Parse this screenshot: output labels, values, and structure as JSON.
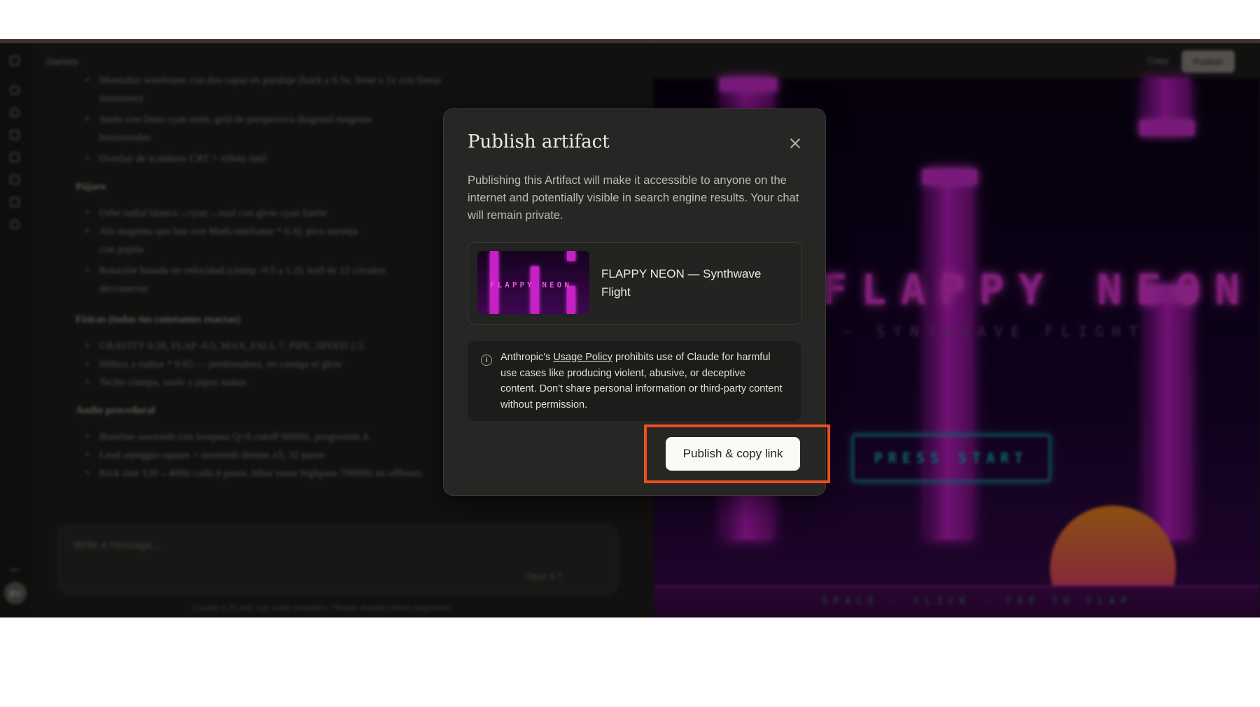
{
  "background": {
    "chat_title": "Games",
    "chat_lines": [
      {
        "text": "Montañas wireframe con dos capas en paralaje (back a 0.5x, front a 1x con líneas",
        "kind": "bullet"
      },
      {
        "text": "interiores)",
        "kind": "cont"
      },
      {
        "text": "Suelo con línea cyan neón, grid de perspectiva diagonal magenta",
        "kind": "bullet"
      },
      {
        "text": "horizontales",
        "kind": "cont"
      },
      {
        "text": "Overlay de scanlines CRT + viñeta sutil",
        "kind": "bullet"
      },
      {
        "text": "Pájaro",
        "kind": "heading"
      },
      {
        "text": "Orbe radial blanco→cyan→azul con glow cyan fuerte",
        "kind": "bullet"
      },
      {
        "text": "Ala magenta que late con Math.sin(frame * 0.4), pico naranja",
        "kind": "bullet"
      },
      {
        "text": "con pupila",
        "kind": "cont"
      },
      {
        "text": "Rotación basada en velocidad (clamp -0.5 a 1.2), trail de 12 círculos",
        "kind": "bullet"
      },
      {
        "text": "desvanecen",
        "kind": "cont"
      },
      {
        "text": "Físicas (todas tus constantes exactas)",
        "kind": "heading"
      },
      {
        "text": "GRAVITY 0.28, FLAP -6.5, MAX_FALL 7, PIPE_SPEED 2.5",
        "kind": "bullet"
      },
      {
        "text": "Hitbox a radius * 0.65 — perdonadora, no castiga el glow",
        "kind": "bullet"
      },
      {
        "text": "Techo clampa, suelo y pipes matan",
        "kind": "bullet"
      },
      {
        "text": "Audio procedural",
        "kind": "heading"
      },
      {
        "text": "Bassline sawtooth con lowpass Q=8 cutoff 600Hz, progresión A",
        "kind": "bullet"
      },
      {
        "text": "Lead arpeggio square + sawtooth detune ±5, 32 pasos",
        "kind": "bullet"
      },
      {
        "text": "Kick sine 120→40Hz cada 4 pasos, hihat noise highpass 7000Hz en offbeats",
        "kind": "bullet"
      }
    ],
    "composer_placeholder": "Write a message...",
    "model_label": "Opus 4.7",
    "disclaimer": "Claude is AI and can make mistakes. Please double-check responses.",
    "avatar_initials": "BV",
    "artifact_copy_label": "Copy",
    "artifact_publish_label": "Publish",
    "game_title": "FLAPPY NEON",
    "game_subtitle": "— SYNTHWAVE FLIGHT —",
    "game_press_start": "PRESS START",
    "game_controls": "SPACE · CLICK · TAP TO FLAP"
  },
  "modal": {
    "title": "Publish artifact",
    "description": "Publishing this Artifact will make it accessible to anyone on the internet and potentially visible in search engine results. Your chat will remain private.",
    "artifact_name": "FLAPPY NEON — Synthwave Flight",
    "thumbnail_text": "FLAPPY NEON",
    "notice_prefix": "Anthropic's ",
    "notice_link": "Usage Policy",
    "notice_suffix": " prohibits use of Claude for harmful use cases like producing violent, abusive, or deceptive content. Don't share personal information or third-party content without permission.",
    "publish_button": "Publish & copy link"
  },
  "colors": {
    "highlight": "#ec4e1f",
    "modal_bg": "#262624",
    "button_bg": "#faf9f5"
  }
}
